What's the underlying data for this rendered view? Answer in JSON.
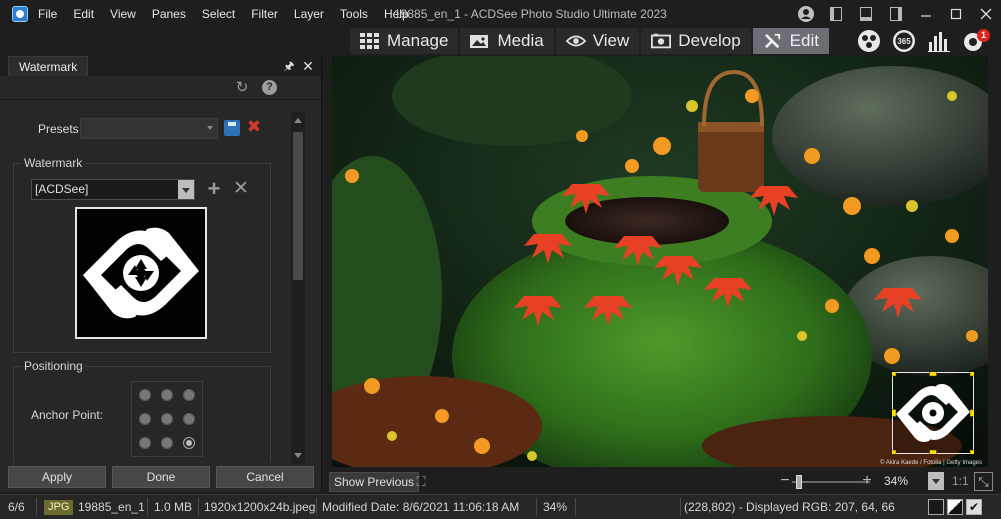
{
  "titlebar": {
    "menu": [
      "File",
      "Edit",
      "View",
      "Panes",
      "Select",
      "Filter",
      "Layer",
      "Tools",
      "Help"
    ],
    "window_title": "19885_en_1 - ACDSee Photo Studio Ultimate 2023"
  },
  "modes": [
    {
      "label": "Manage",
      "icon": "grid-icon",
      "active": false
    },
    {
      "label": "Media",
      "icon": "photos-icon",
      "active": false
    },
    {
      "label": "View",
      "icon": "eye-icon",
      "active": false
    },
    {
      "label": "Develop",
      "icon": "develop-icon",
      "active": false
    },
    {
      "label": "Edit",
      "icon": "brush-icon",
      "active": true
    }
  ],
  "mode_icons": [
    "people-icon",
    "365-icon",
    "dashboard-icon",
    "notifications-icon"
  ],
  "notification_count": "1",
  "panel": {
    "tab": "Watermark",
    "presets_label": "Presets",
    "watermark_group_label": "Watermark",
    "watermark_selected": "[ACDSee]",
    "positioning_group_label": "Positioning",
    "anchor_label": "Anchor Point:",
    "anchor_selected": "bottom-right",
    "buttons": {
      "apply": "Apply",
      "done": "Done",
      "cancel": "Cancel"
    }
  },
  "view_toolbar": {
    "show_previous": "Show Previous",
    "zoom": "34%",
    "actual_size": "1:1",
    "zoom_slider_fraction": 0.1
  },
  "statusbar": {
    "index": "6/6",
    "filetype": "JPG",
    "filename": "19885_en_1",
    "filesize": "1.0 MB",
    "dimensions": "1920x1200x24b.jpeg",
    "modified": "Modified Date: 8/6/2021 11:06:18 AM",
    "zoom": "34%",
    "pixel_info": "(228,802) - Displayed RGB: 207, 64, 66"
  },
  "photo": {
    "caption": "© Akira Kaede / Fotolia | Getty Images"
  },
  "colors": {
    "accent": "#2a7fd0",
    "active_mode": "#6b6f75",
    "selection_handle": "#ffe000",
    "delete_red": "#d23a2c"
  }
}
